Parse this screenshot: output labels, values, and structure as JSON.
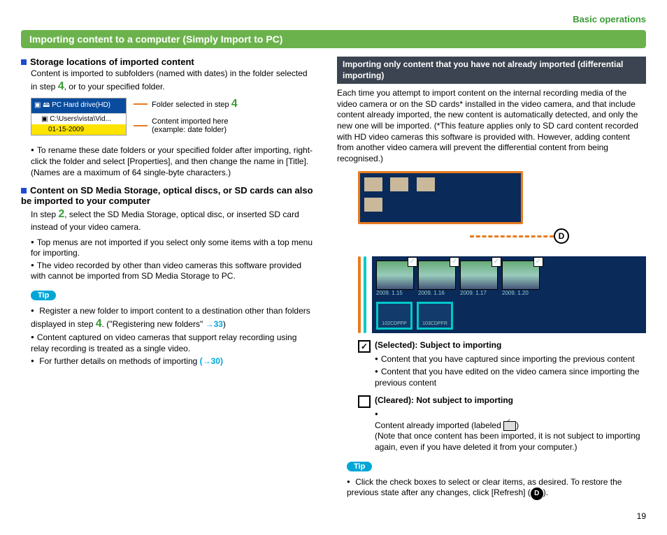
{
  "header": {
    "section": "Basic operations",
    "title": "Importing content to a computer (Simply Import to PC)"
  },
  "left": {
    "h1": "Storage locations of imported content",
    "p1a": "Content is imported to subfolders (named with dates) in the folder selected in step ",
    "p1b": ", or to your specified folder.",
    "step4": "4",
    "tree": {
      "row1": "PC Hard drive(HD)",
      "row2": "C:\\Users\\vista\\Vid...",
      "row3": "01-15-2009"
    },
    "callout1a": "Folder selected in step ",
    "callout2": "Content imported here\n(example: date folder)",
    "bullet1": "To rename these date folders or your specified folder after importing, right-click the folder and select [Properties], and then change the name in [Title]. (Names are a maximum of 64 single-byte characters.)",
    "h2": "Content on SD Media Storage, optical discs, or SD cards can also be imported to your computer",
    "p2a": "In step ",
    "step2": "2",
    "p2b": ", select the SD Media Storage, optical disc, or inserted SD card instead of your video camera.",
    "bullets2": [
      "Top menus are not imported if you select only some items with a top menu for importing.",
      "The video recorded by other than video cameras this software provided with cannot be imported from SD Media Storage to PC."
    ],
    "tip": "Tip",
    "tip_bullets_a": "Register a new folder to import content to a destination other than folders displayed in step ",
    "tip_bullets_a2": ". (\"Registering new folders\" ",
    "tip_link1": "→33",
    "tip_bullets_b": "Content captured on video cameras that support relay recording using relay recording is treated as a single video.",
    "tip_bullets_c": "For further details on methods of importing ",
    "tip_link2": "(→30)"
  },
  "right": {
    "darkbar": "Importing only content that you have not already imported (differential importing)",
    "para": "Each time you attempt to import content on the internal recording media of the video camera or on the SD cards* installed in the video camera, and that include content already imported, the new content is automatically detected, and only the new one will be imported. (*This feature applies only to SD card content recorded with HD video cameras this software is provided with. However, adding content from another video camera will prevent the differential content from being recognised.)",
    "circle_d": "D",
    "dates": [
      "2009. 1.15",
      "2009. 1.16",
      "2009. 1.17",
      "2009. 1.20"
    ],
    "folders": [
      "102CDPFP",
      "103CDPFR"
    ],
    "selected_h": "(Selected): Subject to importing",
    "selected_b": [
      "Content that you have captured since importing the previous content",
      "Content that you have edited on the video camera since importing the previous content"
    ],
    "cleared_h": "(Cleared): Not subject to importing",
    "cleared_b1": "Content already imported (labeled ",
    "cleared_b2": ")\n(Note that once content has been imported, it is not subject to importing again, even if you have deleted it from your computer.)",
    "tip": "Tip",
    "tip_b": "Click the check boxes to select or clear items, as desired. To restore the previous state after any changes, click [Refresh] (",
    "tip_b2": ")."
  },
  "page": "19"
}
